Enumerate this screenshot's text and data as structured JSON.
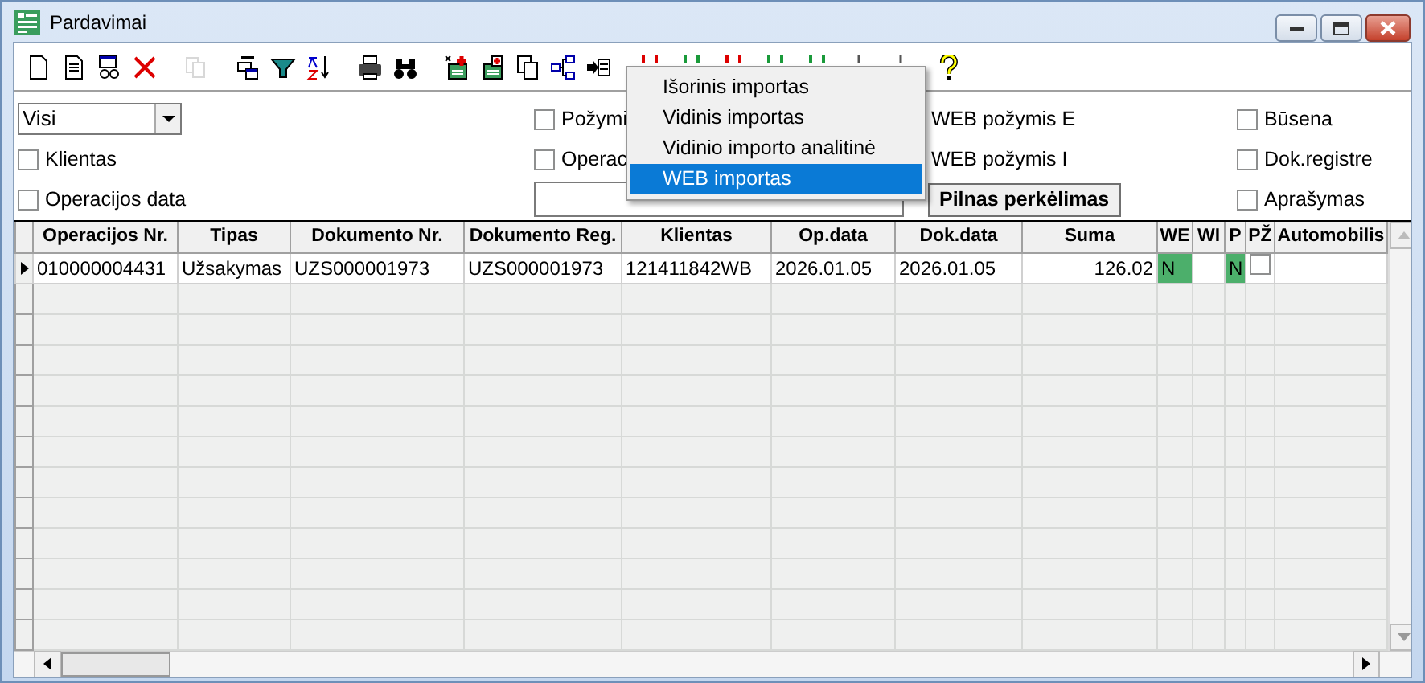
{
  "window": {
    "title": "Pardavimai"
  },
  "toolbar": [
    [
      {
        "kind": "new",
        "disabled": false
      },
      {
        "kind": "doc",
        "disabled": false
      },
      {
        "kind": "view",
        "disabled": false
      },
      {
        "kind": "delete",
        "disabled": false
      }
    ],
    [
      {
        "kind": "copy",
        "disabled": true
      }
    ],
    [
      {
        "kind": "stack",
        "disabled": false
      },
      {
        "kind": "filter",
        "disabled": false
      },
      {
        "kind": "sort",
        "disabled": false
      }
    ],
    [
      {
        "kind": "print",
        "disabled": false
      },
      {
        "kind": "find",
        "disabled": false
      }
    ],
    [
      {
        "kind": "addred",
        "disabled": false
      },
      {
        "kind": "addgreen",
        "disabled": false
      },
      {
        "kind": "pages",
        "disabled": false
      },
      {
        "kind": "tree",
        "disabled": false
      },
      {
        "kind": "arrowwin",
        "disabled": false
      }
    ],
    [
      {
        "kind": "downred",
        "disabled": false
      },
      {
        "kind": "downgreen",
        "disabled": false
      },
      {
        "kind": "downred",
        "disabled": false
      },
      {
        "kind": "downgreen",
        "disabled": false
      },
      {
        "kind": "downgreen",
        "disabled": false
      },
      {
        "kind": "down",
        "disabled": false
      },
      {
        "kind": "down",
        "disabled": false
      }
    ],
    [
      {
        "kind": "help",
        "disabled": false
      }
    ]
  ],
  "filters": [
    {
      "kind": "select",
      "value": "Visi"
    },
    {
      "kind": "checkbox",
      "label": "Požymi",
      "checked": false
    },
    {
      "kind": "text",
      "label": "WEB požymis E"
    },
    {
      "kind": "checkbox",
      "label": "Būsena",
      "checked": false
    },
    {
      "kind": "checkbox",
      "label": "Klientas",
      "checked": false
    },
    {
      "kind": "checkbox",
      "label": "Operac",
      "checked": false
    },
    {
      "kind": "text",
      "label": "WEB požymis I"
    },
    {
      "kind": "checkbox",
      "label": "Dok.registre",
      "checked": false
    },
    {
      "kind": "checkbox",
      "label": "Operacijos data",
      "checked": false
    },
    {
      "kind": "input"
    },
    {
      "kind": "button",
      "label": "Pilnas perkėlimas"
    },
    {
      "kind": "checkbox",
      "label": "Aprašymas",
      "checked": false
    }
  ],
  "menu": {
    "items": [
      {
        "label": "Išorinis importas",
        "selected": false
      },
      {
        "label": "Vidinis importas",
        "selected": false
      },
      {
        "label": "Vidinio importo analitinė",
        "selected": false
      },
      {
        "label": "WEB importas",
        "selected": true
      }
    ]
  },
  "table": {
    "columns": [
      {
        "label": "Operacijos Nr.",
        "kind": "text"
      },
      {
        "label": "Tipas",
        "kind": "text"
      },
      {
        "label": "Dokumento Nr.",
        "kind": "text"
      },
      {
        "label": "Dokumento Reg.",
        "kind": "text"
      },
      {
        "label": "Klientas",
        "kind": "text"
      },
      {
        "label": "Op.data",
        "kind": "text"
      },
      {
        "label": "Dok.data",
        "kind": "text"
      },
      {
        "label": "Suma",
        "kind": "number"
      },
      {
        "label": "WE",
        "kind": "text"
      },
      {
        "label": "WI",
        "kind": "text"
      },
      {
        "label": "P",
        "kind": "text"
      },
      {
        "label": "PŽ",
        "kind": "text"
      },
      {
        "label": "Automobilis",
        "kind": "text"
      }
    ],
    "rows": [
      {
        "selected": true,
        "cells": [
          {
            "text": "010000004431"
          },
          {
            "text": "Užsakymas"
          },
          {
            "text": "UZS000001973"
          },
          {
            "text": "UZS000001973"
          },
          {
            "text": "121411842WB"
          },
          {
            "text": "2026.01.05"
          },
          {
            "text": "2026.01.05"
          },
          {
            "text": "126.02"
          },
          {
            "text": "N",
            "color": "#4caf6b"
          },
          {
            "text": ""
          },
          {
            "text": "N",
            "color": "#4caf6b"
          },
          {
            "kind": "checkbox",
            "checked": false
          },
          {
            "text": ""
          }
        ]
      }
    ]
  }
}
